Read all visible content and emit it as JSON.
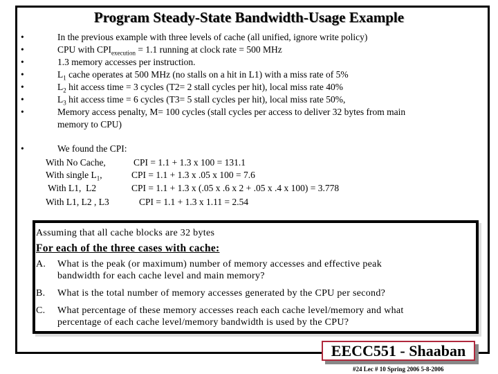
{
  "title": "Program Steady-State Bandwidth-Usage Example",
  "bullet_symbol": "•",
  "bullets": [
    {
      "pre": "In the previous example with three  levels of cache   (all unified, ignore write policy)",
      "sub": "",
      "post": ""
    },
    {
      "pre": "CPU with CPI",
      "sub": "execution",
      "post": " = 1.1  running at clock rate = 500 MHz"
    },
    {
      "pre": "1.3 memory accesses per instruction.",
      "sub": "",
      "post": ""
    },
    {
      "pre": "L",
      "sub": "1",
      "post": " cache operates at 500 MHz (no stalls on a hit in L1) with a miss rate of 5%"
    },
    {
      "pre": "L",
      "sub": "2",
      "post": " hit access time = 3 cycles (T2= 2  stall cycles per hit),  local miss rate  40%"
    },
    {
      "pre": "L",
      "sub": "3",
      "post": " hit access time = 6 cycles (T3= 5 stall cycles per hit), local miss rate 50%,"
    },
    {
      "pre": "Memory access penalty,  M= 100 cycles  (stall cycles per access to deliver 32 bytes from main",
      "sub": "",
      "post": ""
    },
    {
      "pre": "memory  to CPU)",
      "sub": "",
      "post": ""
    }
  ],
  "found": {
    "heading": "We found the CPI:",
    "rows": [
      {
        "label": "With No Cache,",
        "label_sub": "",
        "eq": "CPI  =  1.1 +  1.3 x 100  =  131.1"
      },
      {
        "label": "With single L",
        "label_sub": "1",
        "label_post": ",",
        "eq": "CPI  =  1.1  +  1.3 x .05 x 100 =  7.6"
      },
      {
        "label": " With L1,  L2",
        "label_sub": "",
        "eq": "CPI  =  1.1  +  1.3 x  (.05 x  .6  x 2  +  .05 x  .4  x  100)  = 3.778"
      },
      {
        "label": "With L1,  L2 , L3",
        "label_sub": "",
        "eq": "CPI = 1.1 +  1.3 x 1.11  =   2.54"
      }
    ]
  },
  "questions": {
    "assumption": "Assuming that all cache blocks are 32 bytes",
    "heading": "For each of the  three cases with cache:",
    "items": [
      {
        "letter": "A.",
        "line1": "What is the peak (or maximum) number of memory accesses and effective peak",
        "line2": "bandwidth for each cache level and main memory?"
      },
      {
        "letter": "B.",
        "line1": "What is the total number of memory accesses generated by the CPU per second?",
        "line2": ""
      },
      {
        "letter": "C.",
        "line1": "What percentage of these memory accesses reach each cache level/memory and what",
        "line2": "percentage of each cache level/memory bandwidth is used by the CPU?"
      }
    ]
  },
  "footer": {
    "badge": "EECC551 - Shaaban",
    "info": "#24   Lec # 10  Spring 2006  5-8-2006",
    "badge_border_color": "#b0283c"
  }
}
